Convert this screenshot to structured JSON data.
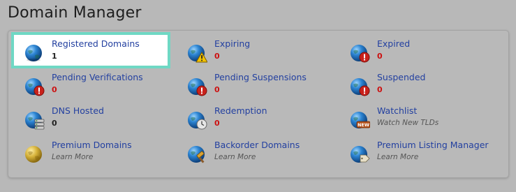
{
  "page": {
    "title": "Domain Manager"
  },
  "colors": {
    "link": "#2340a0",
    "alert": "#cc1111",
    "highlight_border": "#6fd8c4",
    "globe": "#1e6fb8"
  },
  "items": [
    {
      "label": "Registered Domains",
      "value": "1",
      "icon": "globe-icon"
    },
    {
      "label": "Expiring",
      "value": "0",
      "icon": "globe-warning-icon"
    },
    {
      "label": "Expired",
      "value": "0",
      "icon": "globe-alert-icon"
    },
    {
      "label": "Pending Verifications",
      "value": "0",
      "icon": "globe-alert-icon"
    },
    {
      "label": "Pending Suspensions",
      "value": "0",
      "icon": "globe-alert-icon"
    },
    {
      "label": "Suspended",
      "value": "0",
      "icon": "globe-alert-icon"
    },
    {
      "label": "DNS Hosted",
      "value": "0",
      "icon": "globe-server-icon"
    },
    {
      "label": "Redemption",
      "value": "0",
      "icon": "globe-clock-icon"
    },
    {
      "label": "Watchlist",
      "value": "Watch New TLDs",
      "icon": "globe-new-icon",
      "badge": "NEW"
    },
    {
      "label": "Premium Domains",
      "value": "Learn More",
      "icon": "gold-globe-icon"
    },
    {
      "label": "Backorder Domains",
      "value": "Learn More",
      "icon": "globe-hammer-icon"
    },
    {
      "label": "Premium Listing Manager",
      "value": "Learn More",
      "icon": "globe-tag-icon"
    }
  ]
}
